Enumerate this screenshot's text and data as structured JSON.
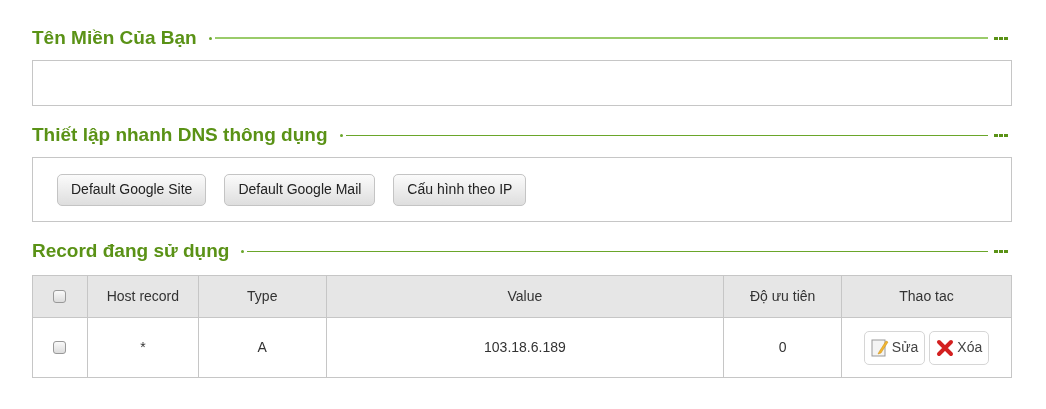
{
  "domain_section": {
    "title": "Tên Miền Của Bạn"
  },
  "quick_dns_section": {
    "title": "Thiết lập nhanh DNS thông dụng",
    "buttons": [
      "Default Google Site",
      "Default Google Mail",
      "Cấu hình theo IP"
    ]
  },
  "records_section": {
    "title": "Record đang sử dụng",
    "table": {
      "select_all_checked": false,
      "columns": [
        "Host record",
        "Type",
        "Value",
        "Độ ưu tiên",
        "Thao tac"
      ],
      "rows": [
        {
          "checked": false,
          "host": "*",
          "type": "A",
          "value": "103.18.6.189",
          "priority": "0",
          "actions": [
            {
              "kind": "edit",
              "label": "Sửa"
            },
            {
              "kind": "delete",
              "label": "Xóa"
            }
          ]
        }
      ]
    }
  }
}
